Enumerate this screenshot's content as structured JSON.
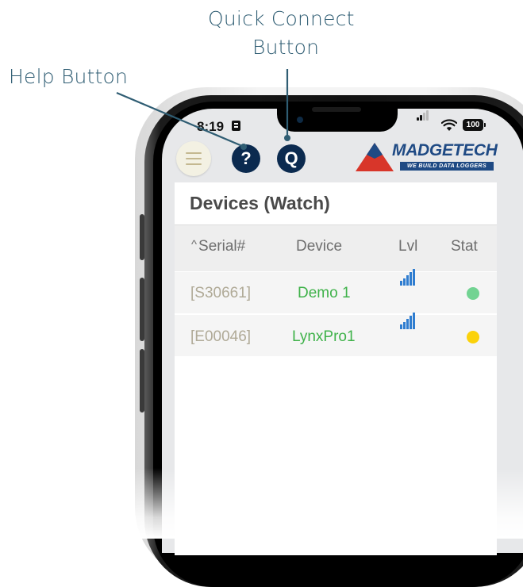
{
  "callouts": {
    "help": "Help Button",
    "quick_connect_line1": "Quick Connect",
    "quick_connect_line2": "Button"
  },
  "status_bar": {
    "time": "8:19",
    "battery": "100"
  },
  "header": {
    "help_glyph": "?",
    "quick_connect_glyph": "Q",
    "logo_name": "MADGETECH",
    "logo_tagline": "WE BUILD DATA LOGGERS"
  },
  "page": {
    "title": "Devices (Watch)"
  },
  "table": {
    "sort_indicator": "^",
    "columns": {
      "serial": "Serial#",
      "device": "Device",
      "lvl": "Lvl",
      "stat": "Stat"
    },
    "rows": [
      {
        "serial": "[S30661]",
        "device": "Demo 1",
        "signal_icon": "signal-bars-icon",
        "status_color": "#72d392"
      },
      {
        "serial": "[E00046]",
        "device": "LynxPro1",
        "signal_icon": "signal-bars-icon",
        "status_color": "#fbd20b"
      }
    ]
  },
  "colors": {
    "accent_navy": "#0b2a4f",
    "callout": "#2f5d73",
    "device_green": "#3fb24a",
    "signal_blue": "#2f7dd0",
    "logo_red": "#d8362a",
    "logo_blue": "#1f4a84"
  }
}
